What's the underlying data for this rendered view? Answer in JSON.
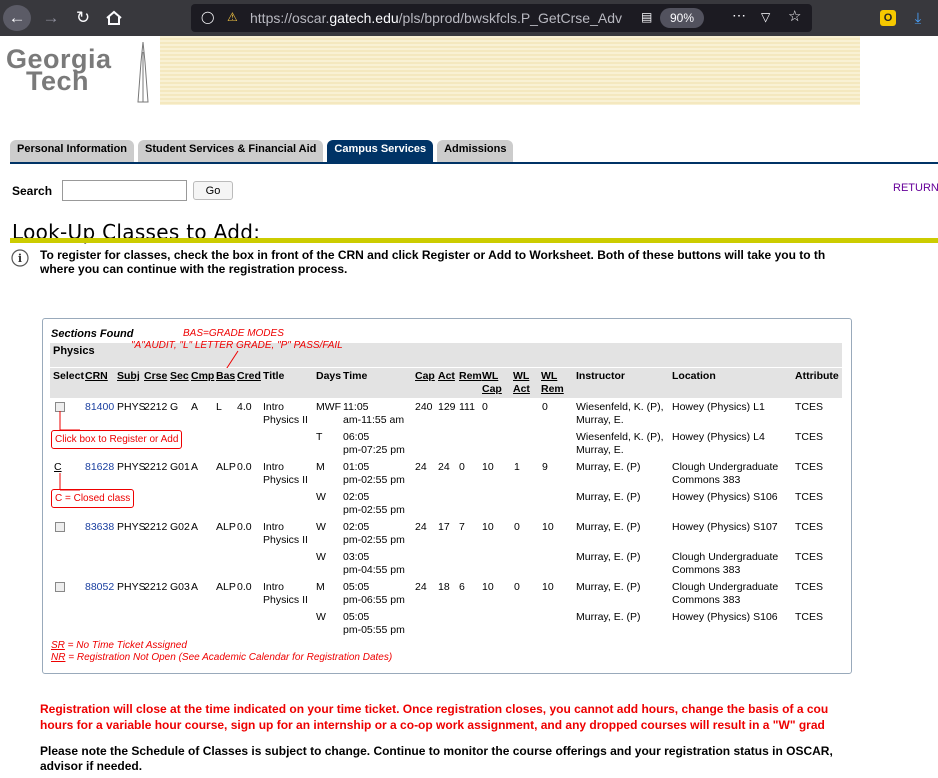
{
  "browser": {
    "url_prefix": "https://oscar.",
    "url_domain": "gatech.edu",
    "url_path": "/pls/bprod/bwskfcls.P_GetCrse_Adv",
    "zoom": "90%"
  },
  "logo": {
    "line1": "Georgia",
    "line2": "Tech"
  },
  "tabs": [
    {
      "label": "Personal Information"
    },
    {
      "label": "Student Services & Financial Aid"
    },
    {
      "label": "Campus Services"
    },
    {
      "label": "Admissions"
    }
  ],
  "search": {
    "label": "Search",
    "value": "",
    "go": "Go"
  },
  "return_link": "RETURN",
  "page_title": "Look-Up Classes to Add:",
  "info_text_1": "To register for classes, check the box in front of the CRN and click Register or Add to Worksheet. Both of these buttons will take you to th",
  "info_text_2": "where you can continue with the registration process.",
  "table": {
    "sections_found": "Sections Found",
    "subject": "Physics",
    "annot_bas": "BAS=GRADE MODES",
    "annot_modes": "\"A\"AUDIT, \"L\" LETTER GRADE, \"P\" PASS/FAIL",
    "headers": [
      "Select",
      "CRN",
      "Subj",
      "Crse",
      "Sec",
      "Cmp",
      "Bas",
      "Cred",
      "Title",
      "Days",
      "Time",
      "Cap",
      "Act",
      "Rem",
      "WL",
      "Cap",
      "WL",
      "Act",
      "WL",
      "Rem",
      "Instructor",
      "Location",
      "Attribute"
    ],
    "callout_register": "Click box to Register or Add",
    "callout_closed": "C = Closed class",
    "closed_letter": "C",
    "rows": [
      {
        "crn": "81400",
        "subj": "PHYS",
        "crse": "2212",
        "sec": "G",
        "cmp": "A",
        "bas": "L",
        "cred": "4.0",
        "title1": "Intro",
        "title2": "Physics II",
        "days": "MWF",
        "time1": "11:05",
        "time2": "am-11:55 am",
        "cap": "240",
        "act": "129",
        "rem": "111",
        "wlcap": "0",
        "wlact": "",
        "wlrem": "0",
        "inst1": "Wiesenfeld, K. (P),",
        "inst2": "Murray, E.",
        "loc1": "Howey (Physics) L1",
        "loc2": "",
        "attr": "TCES"
      },
      {
        "days": "T",
        "time1": "06:05",
        "time2": "pm-07:25 pm",
        "inst1": "Wiesenfeld, K. (P),",
        "inst2": "Murray, E.",
        "loc1": "Howey (Physics) L4",
        "loc2": "",
        "attr": "TCES"
      },
      {
        "crn": "81628",
        "subj": "PHYS",
        "crse": "2212",
        "sec": "G01",
        "cmp": "A",
        "bas": "ALP",
        "cred": "0.0",
        "title1": "Intro",
        "title2": "Physics II",
        "days": "M",
        "time1": "01:05",
        "time2": "pm-02:55 pm",
        "cap": "24",
        "act": "24",
        "rem": "0",
        "wlcap": "10",
        "wlact": "1",
        "wlrem": "9",
        "inst1": "Murray, E. (P)",
        "inst2": "",
        "loc1": "Clough Undergraduate",
        "loc2": "Commons 383",
        "attr": "TCES"
      },
      {
        "days": "W",
        "time1": "02:05",
        "time2": "pm-02:55 pm",
        "inst1": "Murray, E. (P)",
        "inst2": "",
        "loc1": "Howey (Physics) S106",
        "loc2": "",
        "attr": "TCES"
      },
      {
        "crn": "83638",
        "subj": "PHYS",
        "crse": "2212",
        "sec": "G02",
        "cmp": "A",
        "bas": "ALP",
        "cred": "0.0",
        "title1": "Intro",
        "title2": "Physics II",
        "days": "W",
        "time1": "02:05",
        "time2": "pm-02:55 pm",
        "cap": "24",
        "act": "17",
        "rem": "7",
        "wlcap": "10",
        "wlact": "0",
        "wlrem": "10",
        "inst1": "Murray, E. (P)",
        "inst2": "",
        "loc1": "Howey (Physics) S107",
        "loc2": "",
        "attr": "TCES"
      },
      {
        "days": "W",
        "time1": "03:05",
        "time2": "pm-04:55 pm",
        "inst1": "Murray, E. (P)",
        "inst2": "",
        "loc1": "Clough Undergraduate",
        "loc2": "Commons 383",
        "attr": "TCES"
      },
      {
        "crn": "88052",
        "subj": "PHYS",
        "crse": "2212",
        "sec": "G03",
        "cmp": "A",
        "bas": "ALP",
        "cred": "0.0",
        "title1": "Intro",
        "title2": "Physics II",
        "days": "M",
        "time1": "05:05",
        "time2": "pm-06:55 pm",
        "cap": "24",
        "act": "18",
        "rem": "6",
        "wlcap": "10",
        "wlact": "0",
        "wlrem": "10",
        "inst1": "Murray, E. (P)",
        "inst2": "",
        "loc1": "Clough Undergraduate",
        "loc2": "Commons 383",
        "attr": "TCES"
      },
      {
        "days": "W",
        "time1": "05:05",
        "time2": "pm-05:55 pm",
        "inst1": "Murray, E. (P)",
        "inst2": "",
        "loc1": "Howey (Physics) S106",
        "loc2": "",
        "attr": "TCES"
      }
    ],
    "legend_sr_code": "SR",
    "legend_sr": " = No Time Ticket Assigned",
    "legend_nr_code": "NR",
    "legend_nr": " = Registration Not Open (See Academic Calendar for Registration Dates)"
  },
  "warning_1": "Registration will close at the time indicated on your time ticket. Once registration closes, you cannot add hours, change the basis of a cou",
  "warning_2": "hours for a variable hour course, sign up for an internship or a co-op work assignment, and any dropped courses will result in a \"W\" grad",
  "note_1": "Please note the Schedule of Classes is subject to change. Continue to monitor the course offerings and your registration status in OSCAR,",
  "note_2": "advisor if needed.",
  "colors": {
    "tab_active": "#003366",
    "rule": "#cccc00",
    "annotation": "#ee0000",
    "link": "#1a3fa0"
  }
}
